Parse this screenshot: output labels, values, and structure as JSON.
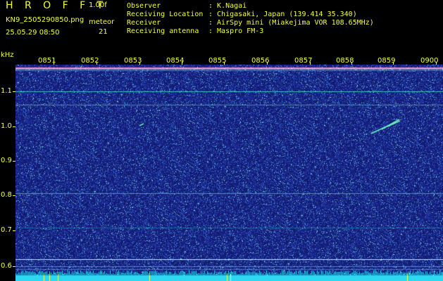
{
  "header": {
    "app_title": "H R O F F T",
    "version": "1.00f",
    "filename": "KN9_2505290850.png",
    "datetime": "25.05.29 08:50",
    "meteor_label": "meteor",
    "meteor_count": "21"
  },
  "info": [
    {
      "key": "Observer",
      "value": ": K.Nagai"
    },
    {
      "key": "Receiving Location",
      "value": ": Chigasaki, Japan (139.414 35.340)"
    },
    {
      "key": "Receiver",
      "value": ": AirSpy mini (Miakejima VOR 108.65MHz)"
    },
    {
      "key": "Receiving antenna",
      "value": ": Maspro FM-3"
    }
  ],
  "axes": {
    "y_unit": "kHz",
    "y_ticks": [
      "1.1",
      "1.0",
      "0.9",
      "0.8",
      "0.7",
      "0.6"
    ],
    "x_ticks": [
      "0851",
      "0852",
      "0853",
      "0854",
      "0855",
      "0856",
      "0857",
      "0858",
      "0859",
      "0900"
    ]
  },
  "colors": {
    "background": "#000000",
    "label": "#f4ff3a",
    "noise_base": "#141c6e",
    "signal": "#36e0c8",
    "carrier": "#ff80c0"
  }
}
